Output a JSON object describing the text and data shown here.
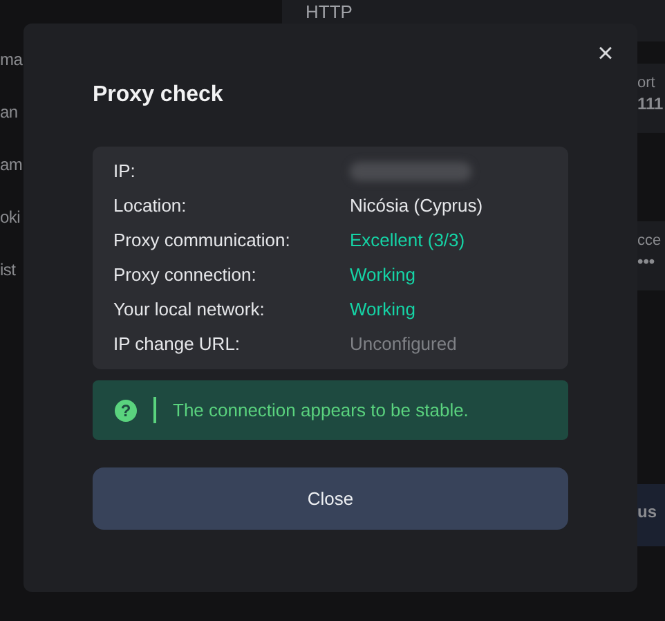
{
  "background": {
    "left_fragments": [
      "ma",
      "an",
      "am",
      "oki",
      "ist"
    ],
    "top_card": {
      "value": "HTTP"
    },
    "port_card": {
      "label": "ort",
      "value": "111"
    },
    "access_card": {
      "label": "cce",
      "value": "•••"
    },
    "button_fragment": "us"
  },
  "dialog": {
    "title": "Proxy check",
    "close_icon": "×",
    "rows": [
      {
        "label": "IP:",
        "kind": "redacted"
      },
      {
        "label": "Location:",
        "value": "Nicósia (Cyprus)",
        "kind": "normal"
      },
      {
        "label": "Proxy communication:",
        "value": "Excellent (3/3)",
        "kind": "good"
      },
      {
        "label": "Proxy connection:",
        "value": "Working",
        "kind": "good"
      },
      {
        "label": "Your local network:",
        "value": "Working",
        "kind": "good"
      },
      {
        "label": "IP change URL:",
        "value": "Unconfigured",
        "kind": "muted"
      }
    ],
    "notice": {
      "text": "The connection appears to be stable.",
      "icon": "?",
      "kind": "success"
    },
    "button": "Close"
  }
}
